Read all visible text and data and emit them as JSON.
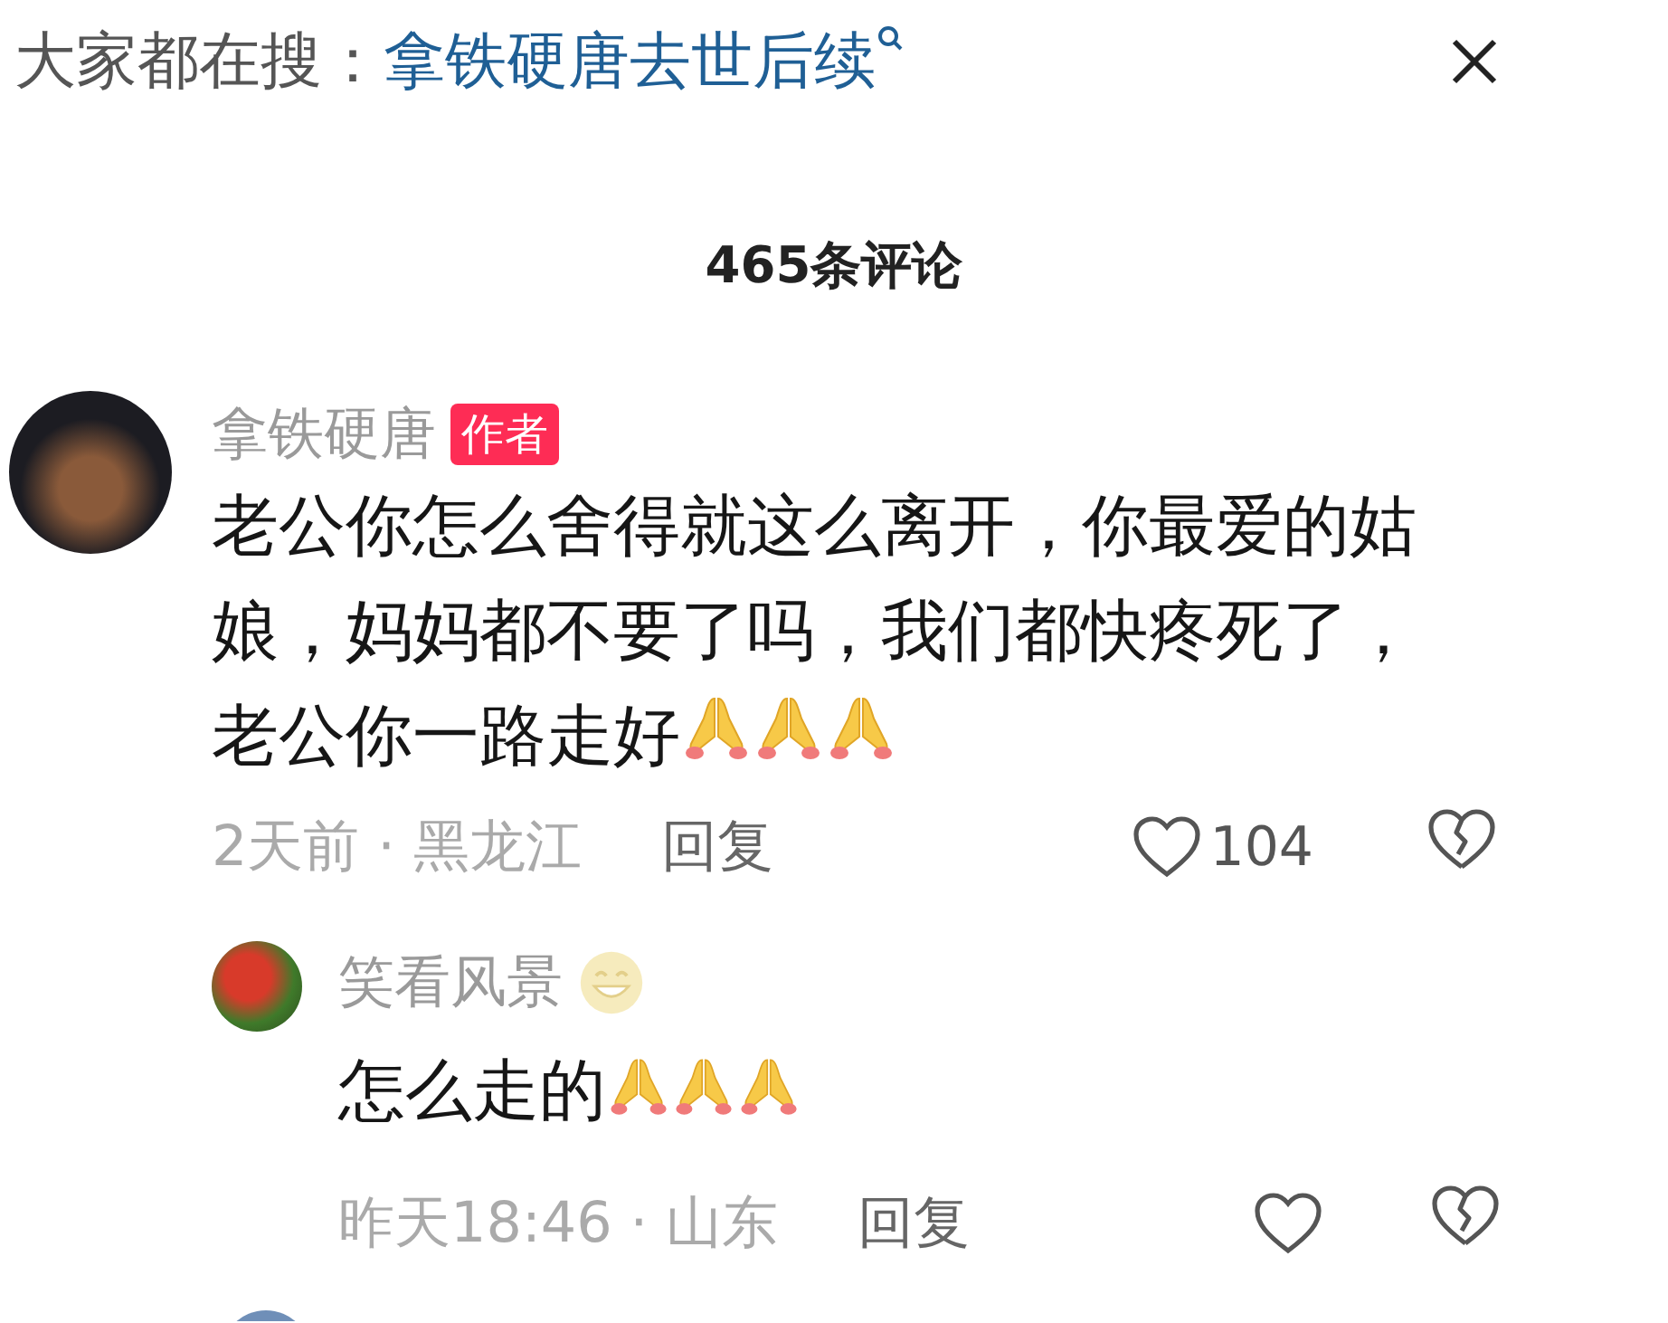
{
  "search_bar": {
    "label": "大家都在搜：",
    "query": "拿铁硬唐去世后续"
  },
  "comment_count": "465条评论",
  "comments": [
    {
      "author": "拿铁硬唐",
      "author_badge": "作者",
      "text": "老公你怎么舍得就这么离开，你最爱的姑娘，妈妈都不要了吗，我们都快疼死了，老公你一路走好",
      "emojis": [
        {
          "kind": "pray"
        },
        {
          "kind": "pray"
        },
        {
          "kind": "pray"
        }
      ],
      "meta": "2天前 · 黑龙江",
      "reply": "回复",
      "likes": "104",
      "liked": false,
      "disliked": false,
      "replies": [
        {
          "author": "笑看风景",
          "author_emoji": [
            {
              "kind": "smile"
            }
          ],
          "text": "怎么走的",
          "emojis": [
            {
              "kind": "pray"
            },
            {
              "kind": "pray"
            },
            {
              "kind": "pray"
            }
          ],
          "meta": "昨天18:46 · 山东",
          "reply": "回复",
          "liked": false,
          "disliked": false
        }
      ]
    }
  ]
}
